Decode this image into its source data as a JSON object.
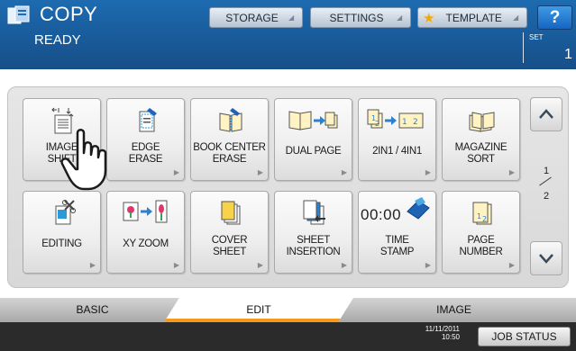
{
  "header": {
    "title": "COPY",
    "app_icon": "copy-app-icon",
    "status": "READY",
    "set_label": "SET",
    "set_count": "1",
    "buttons": {
      "storage": "STORAGE",
      "settings": "SETTINGS",
      "template": "TEMPLATE",
      "help": "?"
    }
  },
  "functions": [
    {
      "line1": "IMAGE",
      "line2": "SHIFT",
      "icon": "image-shift-icon"
    },
    {
      "line1": "EDGE",
      "line2": "ERASE",
      "icon": "edge-erase-icon"
    },
    {
      "line1": "BOOK CENTER",
      "line2": "ERASE",
      "icon": "book-center-erase-icon"
    },
    {
      "line1": "DUAL PAGE",
      "line2": "",
      "icon": "dual-page-icon"
    },
    {
      "line1": "2IN1 / 4IN1",
      "line2": "",
      "icon": "2in1-4in1-icon"
    },
    {
      "line1": "MAGAZINE",
      "line2": "SORT",
      "icon": "magazine-sort-icon"
    },
    {
      "line1": "EDITING",
      "line2": "",
      "icon": "editing-icon"
    },
    {
      "line1": "XY ZOOM",
      "line2": "",
      "icon": "xy-zoom-icon"
    },
    {
      "line1": "COVER",
      "line2": "SHEET",
      "icon": "cover-sheet-icon"
    },
    {
      "line1": "SHEET",
      "line2": "INSERTION",
      "icon": "sheet-insertion-icon"
    },
    {
      "line1": "TIME",
      "line2": "STAMP",
      "icon": "time-stamp-icon",
      "icon_text": "00:00"
    },
    {
      "line1": "PAGE",
      "line2": "NUMBER",
      "icon": "page-number-icon"
    }
  ],
  "pagination": {
    "current": "1",
    "total": "2"
  },
  "tabs": {
    "basic": "BASIC",
    "edit": "EDIT",
    "image": "IMAGE",
    "active": "EDIT"
  },
  "footer": {
    "date": "11/11/2011",
    "time": "10:50",
    "job_status": "JOB STATUS"
  },
  "colors": {
    "header_blue": "#1a5fa0",
    "active_tab_accent": "#f39a1f",
    "footer_bg": "#2b2b2b"
  }
}
